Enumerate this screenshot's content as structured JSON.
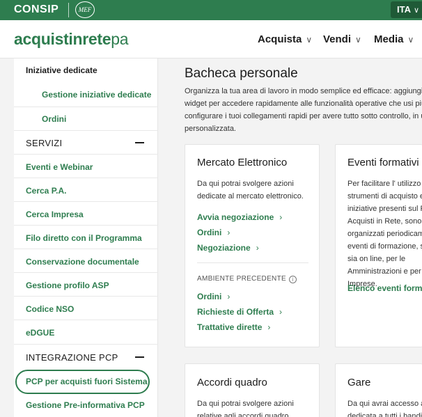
{
  "topbar": {
    "brand": "CONSIP",
    "mef": "MEF",
    "language": "ITA",
    "language_chevron": "chevron-down-icon"
  },
  "header": {
    "logo_main": "acquistinrete",
    "logo_pa": "pa",
    "nav": [
      {
        "label": "Acquista",
        "icon": "chevron-down-icon"
      },
      {
        "label": "Vendi",
        "icon": "chevron-down-icon"
      },
      {
        "label": "Media",
        "icon": "chevron-down-icon"
      }
    ]
  },
  "sidebar": {
    "top_item": "Iniziative dedicate",
    "sub_items": [
      "Gestione iniziative dedicate",
      "Ordini"
    ],
    "servizi_title": "SERVIZI",
    "servizi_items": [
      "Eventi e Webinar",
      "Cerca P.A.",
      "Cerca Impresa",
      "Filo diretto con il Programma",
      "Conservazione documentale",
      "Gestione profilo ASP",
      "Codice NSO",
      "eDGUE"
    ],
    "pcp_title": "INTEGRAZIONE PCP",
    "pcp_items": [
      "PCP per acquisti fuori Sistema",
      "Gestione Pre-informativa PCP"
    ],
    "active_item": "PCP per acquisti fuori Sistema"
  },
  "main": {
    "title": "Bacheca personale",
    "intro_lines": [
      "Organizza la tua area di lavoro in modo semplice ed efficace: aggiungi, r",
      "widget per accedere rapidamente alle funzionalità operative che usi più",
      "configurare i tuoi collegamenti rapidi per avere tutto sotto controllo, in u",
      "personalizzata."
    ]
  },
  "cards": {
    "mercato": {
      "title": "Mercato Elettronico",
      "desc_lines": [
        "Da qui potrai svolgere azioni",
        "dedicate al mercato elettronico."
      ],
      "links": [
        "Avvia negoziazione",
        "Ordini",
        "Negoziazione"
      ],
      "subheading": "AMBIENTE PRECEDENTE",
      "sub_links": [
        "Ordini",
        "Richieste di Offerta",
        "Trattative dirette"
      ]
    },
    "eventi": {
      "title": "Eventi formativi",
      "desc_lines": [
        "Per facilitare l' utilizzo d",
        "strumenti di acquisto e",
        "iniziative presenti sul P",
        "Acquisti in Rete, sono",
        "organizzati periodicam",
        "eventi di formazione, s",
        "sia on line, per le",
        "Amministrazioni e per",
        "Imprese."
      ],
      "link": "Elenco eventi format"
    },
    "accordi": {
      "title": "Accordi quadro",
      "desc_lines": [
        "Da qui potrai svolgere azioni",
        "relative agli accordi quadro."
      ]
    },
    "gare": {
      "title": "Gare",
      "desc_lines": [
        "Da qui avrai accesso a",
        "dedicata a tutti i bandi"
      ]
    }
  },
  "colors": {
    "brand_green": "#2e7d4f",
    "dark_green": "#1f5a37",
    "page_bg": "#f3f3f3"
  }
}
